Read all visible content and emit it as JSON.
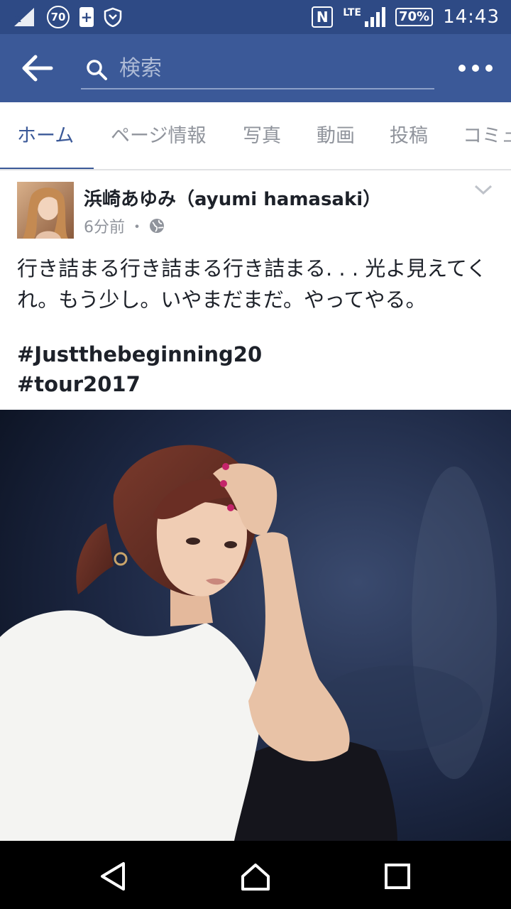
{
  "status_bar": {
    "circle_badge": "70",
    "lte_label": "LTE",
    "battery": "70%",
    "time": "14:43"
  },
  "toolbar": {
    "search_placeholder": "検索"
  },
  "tabs": [
    {
      "label": "ホーム",
      "active": true
    },
    {
      "label": "ページ情報",
      "active": false
    },
    {
      "label": "写真",
      "active": false
    },
    {
      "label": "動画",
      "active": false
    },
    {
      "label": "投稿",
      "active": false
    },
    {
      "label": "コミュ",
      "active": false
    }
  ],
  "post": {
    "author": "浜崎あゆみ（ayumi hamasaki）",
    "time_ago": "6分前",
    "separator": "・",
    "text": "行き詰まる行き詰まる行き詰まる. . . 光よ見えてくれ。もう少し。いやまだまだ。やってやる。",
    "hashtags": [
      "#Justthebeginning20",
      "#tour2017"
    ]
  },
  "colors": {
    "brand": "#3b5998",
    "status_bar": "#2e4a85",
    "tab_inactive": "#90949c"
  }
}
